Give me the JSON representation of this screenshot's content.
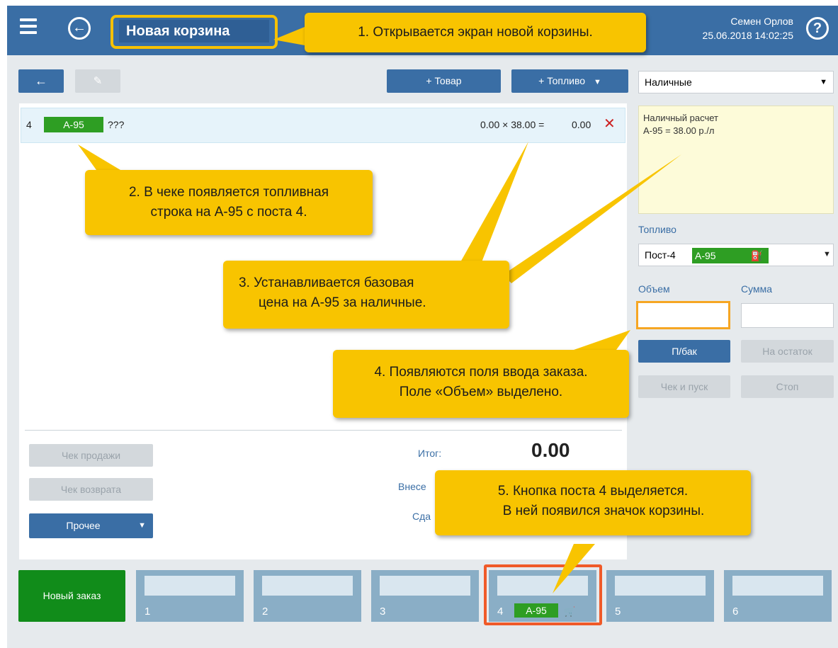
{
  "header": {
    "title": "Новая корзина",
    "user_name": "Семен Орлов",
    "datetime": "25.06.2018 14:02:25",
    "help_label": "?"
  },
  "toolbar": {
    "add_product_label": "+ Товар",
    "add_fuel_label": "+ Топливо"
  },
  "receipt_row": {
    "post": "4",
    "fuel": "А-95",
    "name": "???",
    "formula": "0.00 × 38.00 =",
    "amount": "0.00"
  },
  "totals": {
    "total_label": "Итог:",
    "total_value": "0.00",
    "deposited_label": "Внесе",
    "change_label": "Сда"
  },
  "left_buttons": {
    "sale_check": "Чек продажи",
    "return_check": "Чек возврата",
    "other": "Прочее"
  },
  "right_panel": {
    "payment_type": "Наличные",
    "info_line1": "Наличный расчет",
    "info_line2": "А-95 = 38.00 р./л",
    "fuel_label": "Топливо",
    "fuel_post": "Пост-4",
    "fuel_grade": "А-95",
    "volume_label": "Объем",
    "sum_label": "Сумма",
    "volume_value": "",
    "sum_value": "",
    "full_tank": "П/бак",
    "remainder": "На остаток",
    "check_and_start": "Чек и пуск",
    "stop": "Стоп"
  },
  "posts": {
    "new_order": "Новый заказ",
    "items": [
      {
        "num": "1"
      },
      {
        "num": "2"
      },
      {
        "num": "3"
      },
      {
        "num": "4",
        "fuel": "А-95"
      },
      {
        "num": "5"
      },
      {
        "num": "6"
      }
    ]
  },
  "callouts": {
    "c1": "1. Открывается экран новой корзины.",
    "c2_line1": "2. В чеке появляется топливная",
    "c2_line2": "строка на А-95 с поста 4.",
    "c3_line1": "3. Устанавливается базовая",
    "c3_line2": "цена на А-95 за наличные.",
    "c4_line1": "4. Появляются поля ввода заказа.",
    "c4_line2": "Поле «Объем» выделено.",
    "c5_line1": "5. Кнопка поста 4 выделяется.",
    "c5_line2": "В ней появился значок корзины."
  },
  "colors": {
    "header_blue": "#3a6ea5",
    "callout_yellow": "#f8c400",
    "fuel_green": "#2e9e23",
    "highlight_orange": "#f05a28"
  }
}
